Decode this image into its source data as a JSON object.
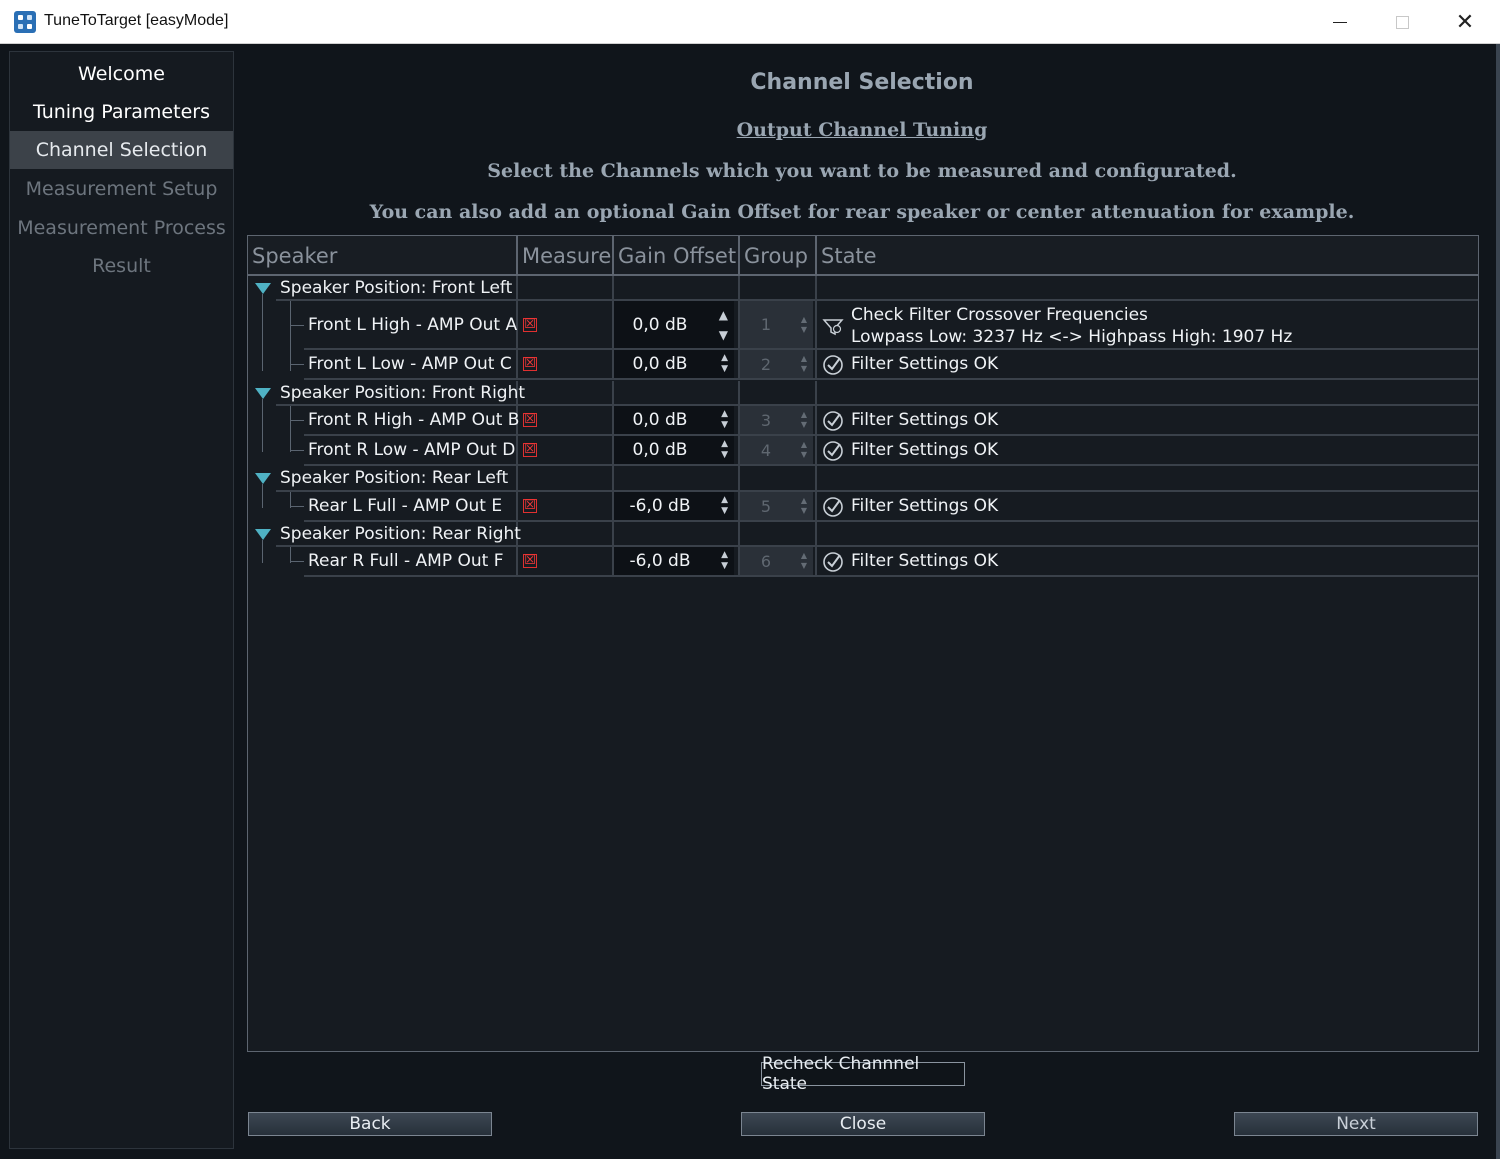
{
  "window": {
    "title": "TuneToTarget [easyMode]",
    "icons": {
      "app": "app-icon",
      "minimize": "minimize-icon",
      "maximize": "maximize-icon",
      "close": "close-icon"
    }
  },
  "sidebar": {
    "items": [
      {
        "label": "Welcome",
        "state": "done"
      },
      {
        "label": "Tuning Parameters",
        "state": "done"
      },
      {
        "label": "Channel Selection",
        "state": "active"
      },
      {
        "label": "Measurement Setup",
        "state": "pending"
      },
      {
        "label": "Measurement Process",
        "state": "pending"
      },
      {
        "label": "Result",
        "state": "pending"
      }
    ]
  },
  "main": {
    "title": "Channel Selection",
    "section": "Output Channel Tuning",
    "description1": "Select the Channels which you want to be measured and configurated.",
    "description2": "You can also add an optional Gain Offset for rear speaker or center attenuation for example."
  },
  "table": {
    "headers": {
      "speaker": "Speaker",
      "measure": "Measure",
      "gain": "Gain Offset",
      "group": "Group",
      "state": "State"
    },
    "groups": [
      {
        "label": "Speaker Position: Front Left",
        "channels": [
          {
            "name": "Front L High - AMP Out A",
            "measure": "☒",
            "gain": "0,0 dB",
            "group": "1",
            "state_line1": "Check Filter Crossover Frequencies",
            "state_line2": "Lowpass Low: 3237 Hz <-> Highpass High: 1907 Hz",
            "state_icon": "filter-icon"
          },
          {
            "name": "Front L Low - AMP Out C",
            "measure": "☒",
            "gain": "0,0 dB",
            "group": "2",
            "state_line1": "Filter Settings OK",
            "state_icon": "check-circle-icon"
          }
        ]
      },
      {
        "label": "Speaker Position: Front Right",
        "channels": [
          {
            "name": "Front R High - AMP Out B",
            "measure": "☒",
            "gain": "0,0 dB",
            "group": "3",
            "state_line1": "Filter Settings OK",
            "state_icon": "check-circle-icon"
          },
          {
            "name": "Front R Low - AMP Out D",
            "measure": "☒",
            "gain": "0,0 dB",
            "group": "4",
            "state_line1": "Filter Settings OK",
            "state_icon": "check-circle-icon"
          }
        ]
      },
      {
        "label": "Speaker Position: Rear Left",
        "channels": [
          {
            "name": "Rear L Full - AMP Out E",
            "measure": "☒",
            "gain": "-6,0 dB",
            "group": "5",
            "state_line1": "Filter Settings OK",
            "state_icon": "check-circle-icon"
          }
        ]
      },
      {
        "label": "Speaker Position: Rear Right",
        "channels": [
          {
            "name": "Rear R Full - AMP Out F",
            "measure": "☒",
            "gain": "-6,0 dB",
            "group": "6",
            "state_line1": "Filter Settings OK",
            "state_icon": "check-circle-icon"
          }
        ]
      }
    ]
  },
  "buttons": {
    "recheck": "Recheck Channnel State",
    "back": "Back",
    "close": "Close",
    "next": "Next"
  },
  "colors": {
    "background": "#10151b",
    "accent_toggle": "#4fb2c4",
    "measure_x": "#ff3a3a",
    "heading_text": "#9aa6b2"
  }
}
